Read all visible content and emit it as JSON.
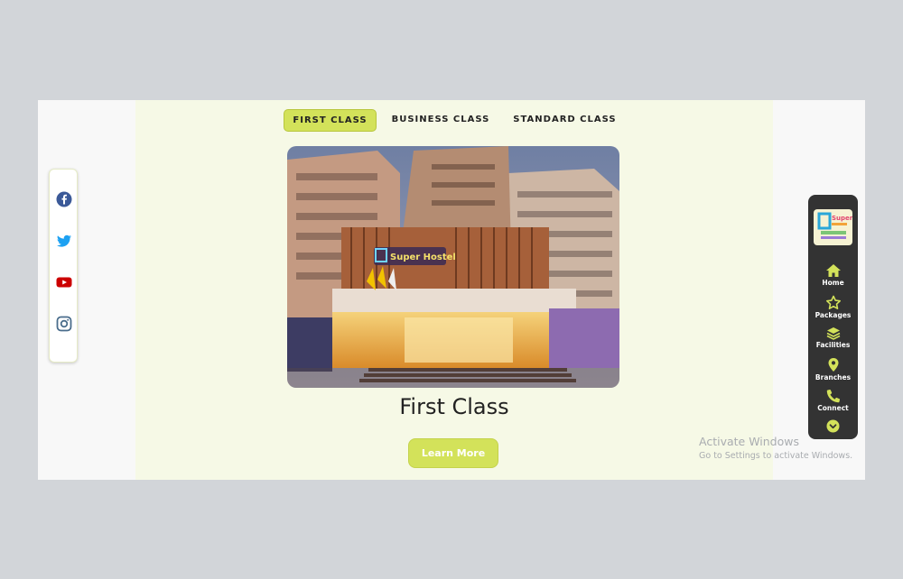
{
  "tabs": [
    {
      "label": "FIRST CLASS",
      "active": true
    },
    {
      "label": "BUSINESS CLASS",
      "active": false
    },
    {
      "label": "STANDARD CLASS",
      "active": false
    }
  ],
  "hero": {
    "title": "First Class",
    "cta_label": "Learn More",
    "image_alt": "hotel-building-photo",
    "signage_text": "Super Hostel"
  },
  "social": [
    "facebook-icon",
    "twitter-icon",
    "youtube-icon",
    "instagram-icon"
  ],
  "right_nav": {
    "logo_text": "Super Home",
    "items": [
      {
        "label": "Home",
        "icon": "home-icon"
      },
      {
        "label": "Packages",
        "icon": "star-icon"
      },
      {
        "label": "Facilities",
        "icon": "layers-icon"
      },
      {
        "label": "Branches",
        "icon": "map-pin-icon"
      },
      {
        "label": "Connect",
        "icon": "phone-icon"
      }
    ],
    "scroll_icon": "chevron-down-circle-icon"
  },
  "watermark": {
    "line1": "Activate Windows",
    "line2": "Go to Settings to activate Windows."
  },
  "colors": {
    "accent": "#d3e25a",
    "content_bg": "#f6f9e6",
    "nav_bg": "#333333",
    "facebook": "#3b5998",
    "twitter": "#1da1f2",
    "youtube": "#cc0000",
    "instagram": "#4a6d8c"
  }
}
